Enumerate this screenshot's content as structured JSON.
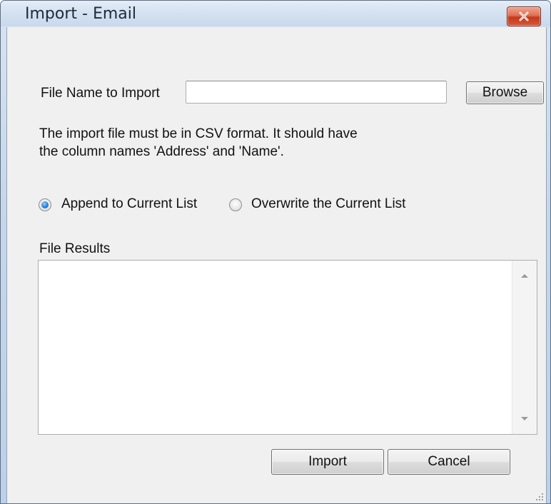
{
  "window": {
    "title": "Import - Email"
  },
  "form": {
    "file_label": "File Name to Import",
    "file_value": "",
    "browse_label": "Browse",
    "help_line1": "The import file must be in CSV format.  It should have",
    "help_line2": "the column names 'Address' and 'Name'.",
    "mode_options": [
      {
        "label": "Append to Current List",
        "checked": true
      },
      {
        "label": "Overwrite the Current List",
        "checked": false
      }
    ],
    "results_label": "File Results",
    "results_text": ""
  },
  "actions": {
    "import_label": "Import",
    "cancel_label": "Cancel"
  },
  "icons": {
    "close": "close-icon",
    "scroll_up": "scroll-up-arrow-icon",
    "scroll_down": "scroll-down-arrow-icon",
    "grip": "resize-grip-icon"
  },
  "colors": {
    "close_button": "#d5583a",
    "radio_selected": "#2b7fd6"
  }
}
